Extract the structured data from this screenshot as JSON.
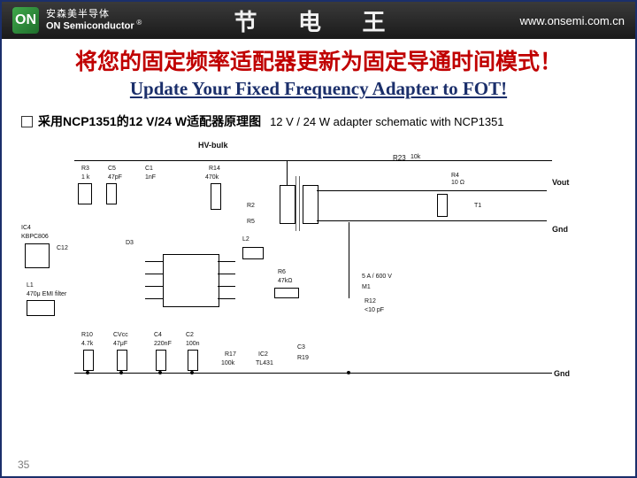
{
  "topbar": {
    "brand_cn": "安森美半导体",
    "brand_en": "ON Semiconductor",
    "reg": "®",
    "center": "节 电 王",
    "url": "www.onsemi.com.cn"
  },
  "heading": {
    "cn": "将您的固定频率适配器更新为固定导通时间模式！",
    "en": "Update Your Fixed Frequency Adapter to FOT!"
  },
  "bullet": {
    "cn": "采用NCP1351的12 V/24 W适配器原理图",
    "en": "12 V / 24 W adapter schematic with NCP1351"
  },
  "schematic": {
    "hv_bulk": "HV-bulk",
    "r3": "R3",
    "r3_val": "1 k",
    "c5": "C5",
    "c5_val": "47pF",
    "c1": "C1",
    "c1_val": "1nF",
    "r14": "R14",
    "r14_val": "470k",
    "r4": "R4",
    "r4_val": "10 Ω",
    "r23": "R23",
    "r23_val": "10k",
    "vout": "Vout",
    "gnd": "Gnd",
    "t1": "T1",
    "r2": "R2",
    "r5": "R5",
    "ic4": "IC4",
    "ic4_part": "KBPC806",
    "c12": "C12",
    "l1": "L1",
    "l1_val": "470μ EMI filter",
    "l2": "L2",
    "r6": "R6",
    "r6_val": "47kΩ",
    "r12": "R12",
    "r12_val": "<10 pF",
    "m1": "M1",
    "m1_part": "5 A / 600 V",
    "d3": "D3",
    "r10": "R10",
    "r10_val": "4.7k",
    "cvcc": "CVcc",
    "cvcc_val": "47μF",
    "c4": "C4",
    "c4_val": "220nF",
    "c2": "C2",
    "c2_val": "100n",
    "ic2": "IC2",
    "ic2_part": "TL431",
    "r17": "R17",
    "r17_val": "100k",
    "c3": "C3",
    "r19": "R19"
  },
  "page_num": "35"
}
